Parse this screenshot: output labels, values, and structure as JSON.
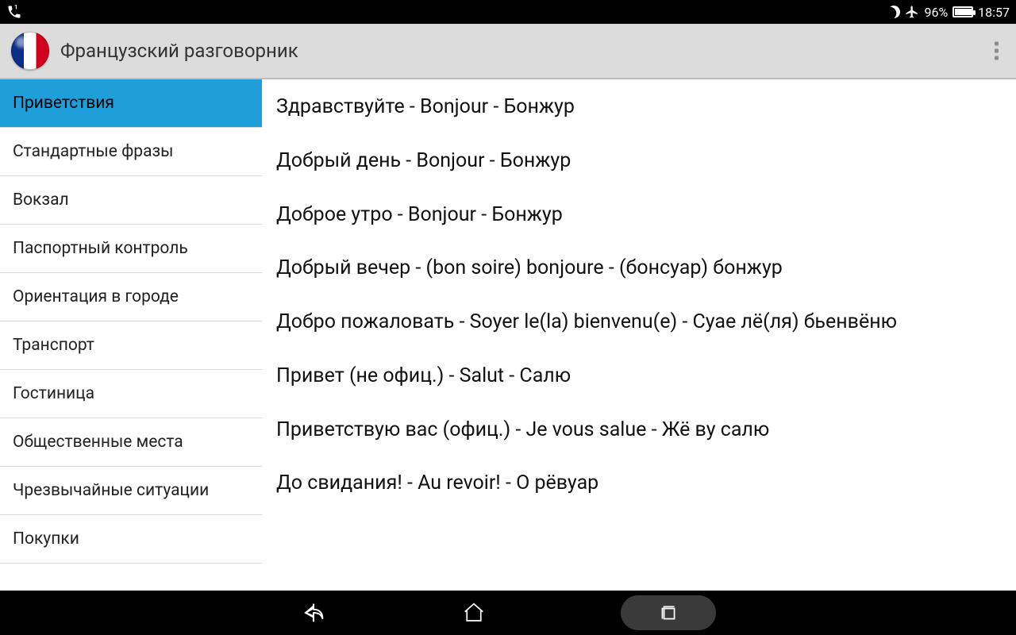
{
  "status": {
    "battery_pct": "96%",
    "time": "18:57"
  },
  "app": {
    "title": "Французский разговорник"
  },
  "sidebar": {
    "items": [
      {
        "label": "Приветствия",
        "active": true
      },
      {
        "label": "Стандартные фразы"
      },
      {
        "label": "Вокзал"
      },
      {
        "label": "Паспортный контроль"
      },
      {
        "label": "Ориентация в городе"
      },
      {
        "label": "Транспорт"
      },
      {
        "label": "Гостиница"
      },
      {
        "label": "Общественные места"
      },
      {
        "label": "Чрезвычайные ситуации"
      },
      {
        "label": "Покупки"
      }
    ]
  },
  "phrases": [
    "Здравствуйте - Bonjour - Бонжур",
    "Добрый день - Bonjour - Бонжур",
    "Доброе утро - Bonjour - Бонжур",
    "Добрый вечер - (bon soire) bonjoure - (бонсуар) бонжур",
    "Добро пожаловать - Soyer le(la) bienvenu(e) - Суае лё(ля) бьенвёню",
    "Привет (не офиц.) - Salut - Салю",
    "Приветствую вас (офиц.) - Je vous salue - Жё ву салю",
    "До свидания! - Au revoir! - О рёвуар"
  ]
}
